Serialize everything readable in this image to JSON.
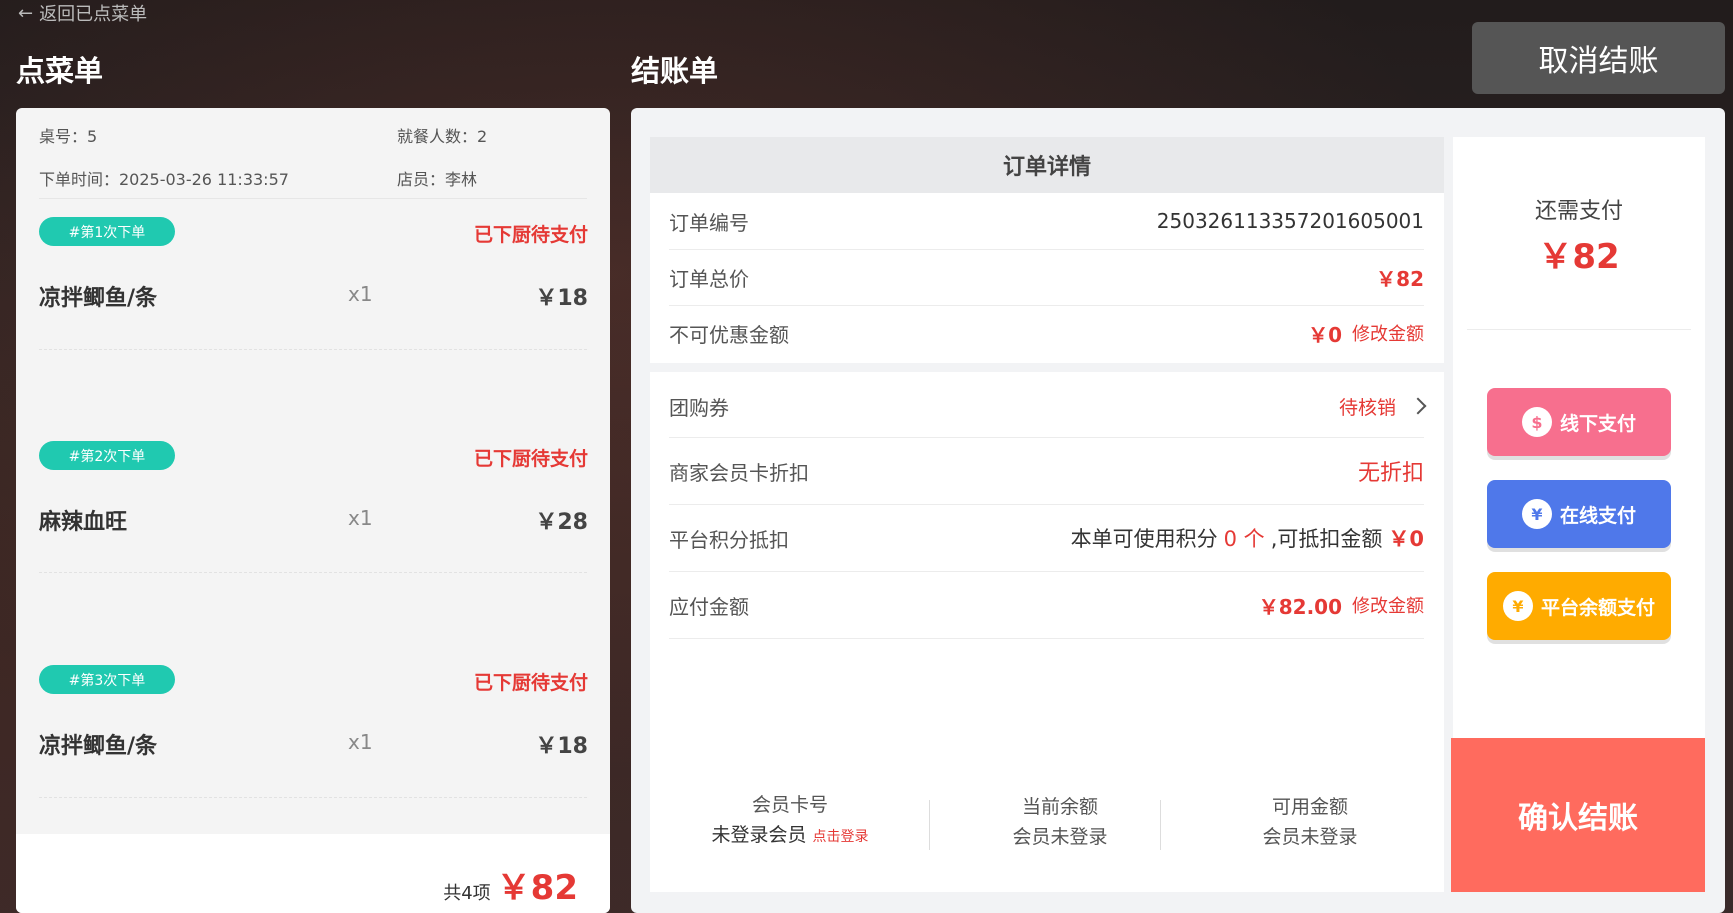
{
  "nav": {
    "back_label": "返回已点菜单"
  },
  "left_title": "点菜单",
  "right_title": "结账单",
  "cancel_label": "取消结账",
  "order_info": {
    "table": "桌号：5",
    "guests": "就餐人数：2",
    "time": "下单时间：2025-03-26 11:33:57",
    "staff": "店员：李林"
  },
  "batches": [
    {
      "tag": "#第1次下单",
      "status": "已下厨待支付",
      "name": "凉拌鲫鱼/条",
      "qty": "x1",
      "price": "￥18"
    },
    {
      "tag": "#第2次下单",
      "status": "已下厨待支付",
      "name": "麻辣血旺",
      "qty": "x1",
      "price": "￥28"
    },
    {
      "tag": "#第3次下单",
      "status": "已下厨待支付",
      "name": "凉拌鲫鱼/条",
      "qty": "x1",
      "price": "￥18"
    }
  ],
  "summary": {
    "count_label": "共4项",
    "total": "￥82"
  },
  "detail": {
    "header": "订单详情",
    "order_no_label": "订单编号",
    "order_no": "25032611335720160500​1",
    "total_label": "订单总价",
    "total": "￥82",
    "nodiscount_label": "不可优惠金额",
    "nodiscount": "￥0",
    "modify": "修改金额"
  },
  "discounts": {
    "coupon_label": "团购券",
    "coupon_value": "待核销",
    "member_label": "商家会员卡折扣",
    "member_value": "无折扣",
    "points_label": "平台积分抵扣",
    "points_prefix": "本单可使用积分",
    "points_count": "0 个",
    "points_mid": ",可抵扣金额",
    "points_amount": "￥0",
    "payable_label": "应付金额",
    "payable": "￥82.00",
    "modify": "修改金额"
  },
  "member": {
    "card_label": "会员卡号",
    "card_value": "未登录会员",
    "login": "点击登录",
    "balance_label": "当前余额",
    "balance_value": "会员未登录",
    "available_label": "可用金额",
    "available_value": "会员未登录"
  },
  "side": {
    "due_label": "还需支付",
    "due_amount": "￥82",
    "offline": "线下支付",
    "online": "在线支付",
    "wallet": "平台余额支付",
    "confirm": "确认结账"
  },
  "colors": {
    "accent_red": "#e53935",
    "teal": "#20c9b0",
    "offline": "#f76f8e",
    "online": "#4f78ea",
    "wallet": "#ffab00",
    "confirm": "#ff6b5e"
  }
}
